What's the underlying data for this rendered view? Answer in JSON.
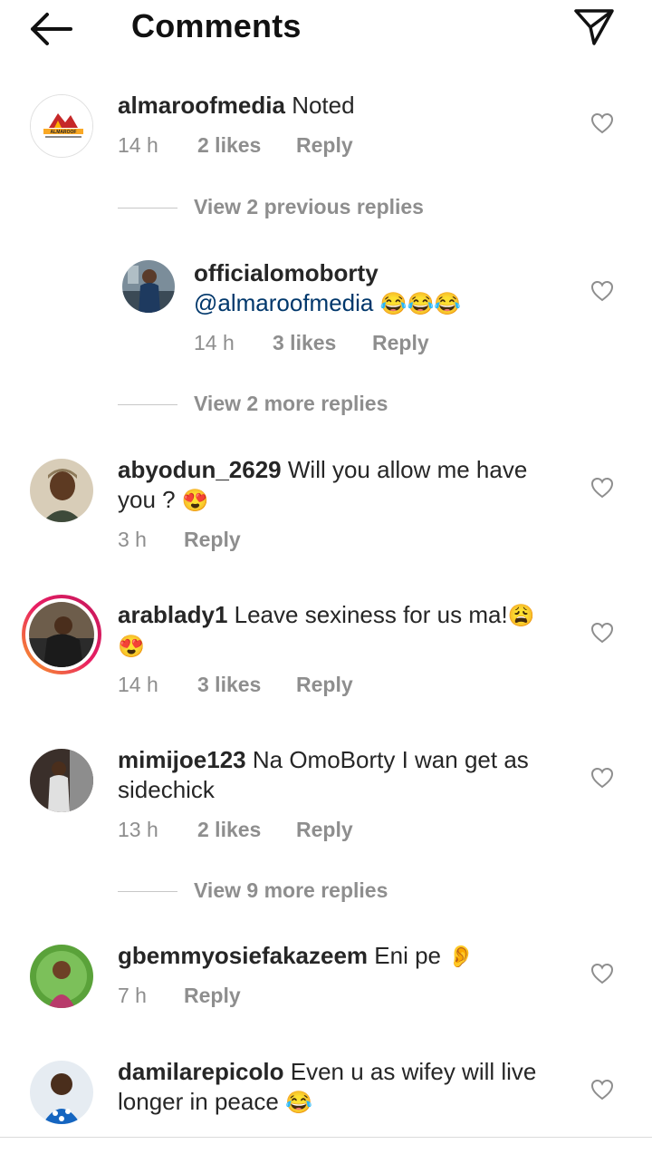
{
  "header": {
    "title": "Comments",
    "back_icon": "back-arrow-icon",
    "share_icon": "paper-plane-icon"
  },
  "comments": [
    {
      "user": "almaroofmedia",
      "text": "Noted",
      "time": "14 h",
      "likes": "2 likes",
      "reply": "Reply",
      "avatar_text": "ALMAROOF"
    },
    {
      "user": "officialomoborty",
      "mention": "@almaroofmedia",
      "emoji": "😂😂😂",
      "time": "14 h",
      "likes": "3 likes",
      "reply": "Reply"
    },
    {
      "user": "abyodun_2629",
      "text": "Will you allow me have you ?",
      "emoji": "😍",
      "time": "3 h",
      "reply": "Reply"
    },
    {
      "user": "arablady1",
      "text": "Leave sexiness for us ma!",
      "emoji": "😩",
      "emoji2": "😍",
      "time": "14 h",
      "likes": "3 likes",
      "reply": "Reply"
    },
    {
      "user": "mimijoe123",
      "text": "Na OmoBorty I wan get as sidechick",
      "time": "13 h",
      "likes": "2 likes",
      "reply": "Reply"
    },
    {
      "user": "gbemmyosiefakazeem",
      "text": "Eni pe",
      "emoji": "👂",
      "time": "7 h",
      "reply": "Reply"
    },
    {
      "user": "damilarepicolo",
      "text": "Even u as wifey will live longer in peace",
      "emoji": "😂"
    }
  ],
  "view_links": {
    "previous": "View 2 previous replies",
    "more_a": "View 2 more replies",
    "more_b": "View 9 more replies"
  },
  "colors": {
    "mention": "#00376b",
    "meta": "#8e8e8e",
    "story_ring_start": "#f9a825",
    "story_ring_end": "#c2185b"
  }
}
